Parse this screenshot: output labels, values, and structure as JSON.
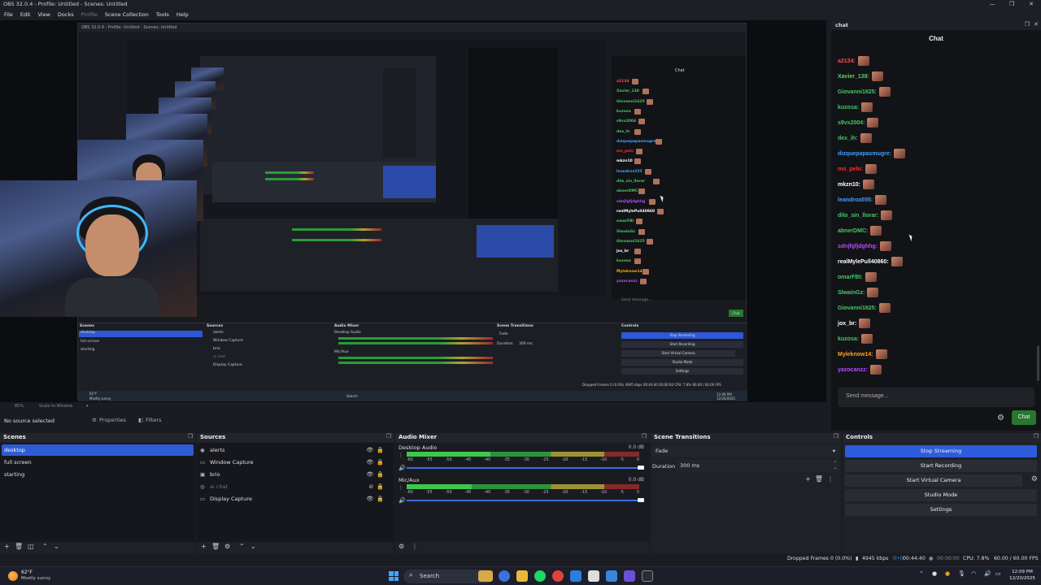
{
  "window": {
    "title": "OBS 32.0.4 - Profile: Untitled - Scenes: Untitled",
    "controls": [
      "—",
      "❐",
      "✕"
    ]
  },
  "menu": [
    "File",
    "Edit",
    "View",
    "Docks",
    "Profile",
    "Scene Collection",
    "Tools",
    "Help"
  ],
  "preview": {
    "nested_title": "OBS 32.0.4 - Profile: Untitled - Scenes: Untitled",
    "mini_chat_title": "Chat",
    "mini_chat_names": [
      "a2134",
      "Xavier_138",
      "Giovanni1625",
      "kuzosa",
      "s9vx2004",
      "dex_ih",
      "dizquepapasmugre",
      "mo_pelo",
      "mkzn10",
      "leandroa555",
      "dilo_sin_llorar",
      "abnerDMC",
      "sdnjfgfjdghhg",
      "realMylePull40860",
      "omarFBI",
      "SlwainGz",
      "Giovanni1625",
      "jox_br",
      "kuzosa",
      "Myleknow14",
      "yazocanzz"
    ],
    "mini_send": "Send message...",
    "mini_chat_btn": "Chat",
    "mini_scenes_title": "Scenes",
    "mini_scenes": [
      "desktop",
      "full screen",
      "starting"
    ],
    "mini_sources_title": "Sources",
    "mini_sources": [
      "alerts",
      "Window Capture",
      "brio",
      "ai chat",
      "Display Capture"
    ],
    "mini_mixer_title": "Audio Mixer",
    "mini_mixer_tracks": [
      "Desktop Audio",
      "Mic/Aux"
    ],
    "mini_trans_title": "Scene Transitions",
    "mini_trans_fade": "Fade",
    "mini_trans_dur_label": "Duration",
    "mini_trans_dur": "300 ms",
    "mini_controls_title": "Controls",
    "mini_controls": [
      "Stop Streaming",
      "Start Recording",
      "Start Virtual Camera",
      "Studio Mode",
      "Settings"
    ],
    "mini_status": "Dropped Frames 0 (0.0%)   4945 kbps   00:44:40   00:00:00   CPU: 7.8%   60.00 / 60.00 FPS",
    "mini_weather": "62°F",
    "mini_weather_desc": "Mostly sunny",
    "mini_search": "Search",
    "mini_clock": "12:09 PM 12/20/2025"
  },
  "scale_bar": {
    "zoom": "85%",
    "mode": "Scale to Window"
  },
  "source_bar": {
    "no_source": "No source selected",
    "properties": "Properties",
    "filters": "Filters"
  },
  "chat": {
    "dock_label": "chat",
    "heading": "Chat",
    "messages": [
      {
        "user": "a2134:",
        "color": "#ff4a4a"
      },
      {
        "user": "Xavier_138:",
        "color": "#4fd46a"
      },
      {
        "user": "Giovanni1625:",
        "color": "#44c766"
      },
      {
        "user": "kuzosa:",
        "color": "#44c766"
      },
      {
        "user": "s9vx2004:",
        "color": "#44c766"
      },
      {
        "user": "dex_ih:",
        "color": "#44c766"
      },
      {
        "user": "dizquepapasmugre:",
        "color": "#3f9fff"
      },
      {
        "user": "mo_pelo:",
        "color": "#ff2b2b"
      },
      {
        "user": "mkzn10:",
        "color": "#ffffff"
      },
      {
        "user": "leandroa555:",
        "color": "#3f9fff"
      },
      {
        "user": "dilo_sin_llorar:",
        "color": "#44c766"
      },
      {
        "user": "abnerDMC:",
        "color": "#44c766"
      },
      {
        "user": "sdnjfgfjdghhg:",
        "color": "#b44cff"
      },
      {
        "user": "realMylePull40860:",
        "color": "#ffffff"
      },
      {
        "user": "omarFBI:",
        "color": "#44c766"
      },
      {
        "user": "SlwainGz:",
        "color": "#44c766"
      },
      {
        "user": "Giovanni1625:",
        "color": "#44c766"
      },
      {
        "user": "jox_br:",
        "color": "#ffffff"
      },
      {
        "user": "kuzosa:",
        "color": "#44c766"
      },
      {
        "user": "Myleknow14:",
        "color": "#ffa31a"
      },
      {
        "user": "yazocanzz:",
        "color": "#b44cff"
      }
    ],
    "input_placeholder": "Send message...",
    "send_label": "Chat"
  },
  "scenes": {
    "title": "Scenes",
    "items": [
      "desktop",
      "full screen",
      "starting"
    ],
    "selected": "desktop"
  },
  "sources": {
    "title": "Sources",
    "items": [
      {
        "name": "alerts",
        "icon": "source-icon",
        "hidden": false
      },
      {
        "name": "Window Capture",
        "icon": "window-icon",
        "hidden": false
      },
      {
        "name": "brio",
        "icon": "camera-icon",
        "hidden": false
      },
      {
        "name": "ai chat",
        "icon": "browser-icon",
        "hidden": true
      },
      {
        "name": "Display Capture",
        "icon": "display-icon",
        "hidden": false
      }
    ]
  },
  "mixer": {
    "title": "Audio Mixer",
    "ticks": [
      "-60",
      "-55",
      "-50",
      "-45",
      "-40",
      "-35",
      "-30",
      "-25",
      "-20",
      "-15",
      "-10",
      "-5",
      "0"
    ],
    "tracks": [
      {
        "name": "Desktop Audio",
        "db": "0.0 dB",
        "level": 0.36,
        "volume": 1.0
      },
      {
        "name": "Mic/Aux",
        "db": "0.0 dB",
        "level": 0.28,
        "volume": 1.0
      }
    ]
  },
  "transitions": {
    "title": "Scene Transitions",
    "type": "Fade",
    "duration_label": "Duration",
    "duration": "300 ms"
  },
  "controls": {
    "title": "Controls",
    "buttons": [
      "Stop Streaming",
      "Start Recording",
      "Start Virtual Camera",
      "Studio Mode",
      "Settings"
    ]
  },
  "status": {
    "dropped": "Dropped Frames 0 (0.0%)",
    "bitrate": "4945 kbps",
    "live_time": "00:44:40",
    "rec_time": "00:00:00",
    "cpu": "CPU: 7.8%",
    "fps": "60.00 / 60.00 FPS"
  },
  "taskbar": {
    "weather_temp": "62°F",
    "weather_desc": "Mostly sunny",
    "search": "Search",
    "time": "12:09 PM",
    "date": "12/20/2025"
  },
  "colors": {
    "accent": "#2e5bd6",
    "send": "#28762f",
    "chat_bg": "#121316"
  }
}
